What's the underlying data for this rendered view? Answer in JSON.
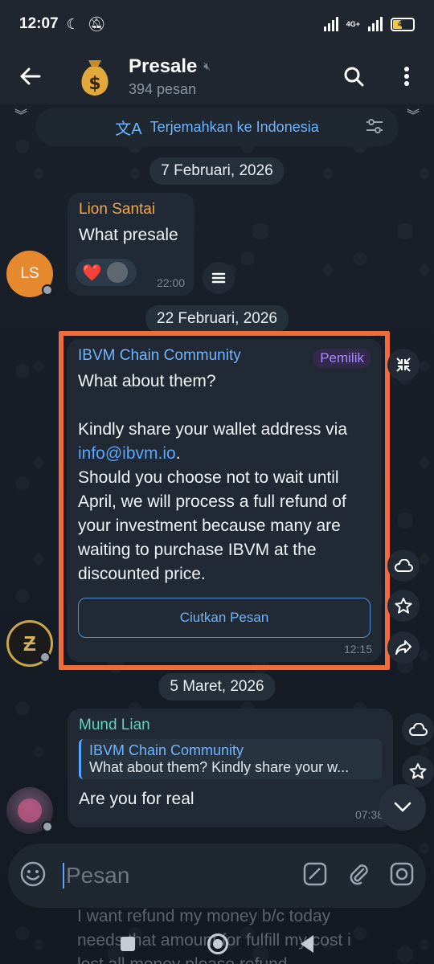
{
  "status_bar": {
    "time": "12:07",
    "network": "4G+",
    "battery": "44"
  },
  "header": {
    "title": "Presale",
    "subtitle": "394 pesan",
    "avatar_emoji": "💰"
  },
  "translate": {
    "label": "Terjemahkan ke Indonesia"
  },
  "dates": {
    "d1": "7 Februari, 2026",
    "d2": "22 Februari, 2026",
    "d3": "5 Maret, 2026"
  },
  "msg1": {
    "sender": "Lion Santai",
    "text": "What presale",
    "time": "22:00",
    "avatar_initials": "LS",
    "reaction": "❤️"
  },
  "msg2": {
    "sender": "IBVM Chain Community",
    "badge": "Pemilik",
    "line1": "What about them?",
    "line2": "Kindly share your wallet address via",
    "link": "info@ibvm.io",
    "link_suffix": ".",
    "line3": "Should you choose not to wait until April, we will process a full refund of your investment because many are waiting to purchase IBVM at the discounted price.",
    "button": "Ciutkan Pesan",
    "time": "12:15"
  },
  "msg3": {
    "sender": "Mund Lian",
    "reply_name": "IBVM Chain Community",
    "reply_text": "What about them?  Kindly share your w...",
    "text": "Are you for real",
    "time": "07:38"
  },
  "input": {
    "placeholder": "Pesan"
  },
  "ghost_text": "I want refund my money b/c today needs that amount for fulfill my cost i lost all money please refund"
}
